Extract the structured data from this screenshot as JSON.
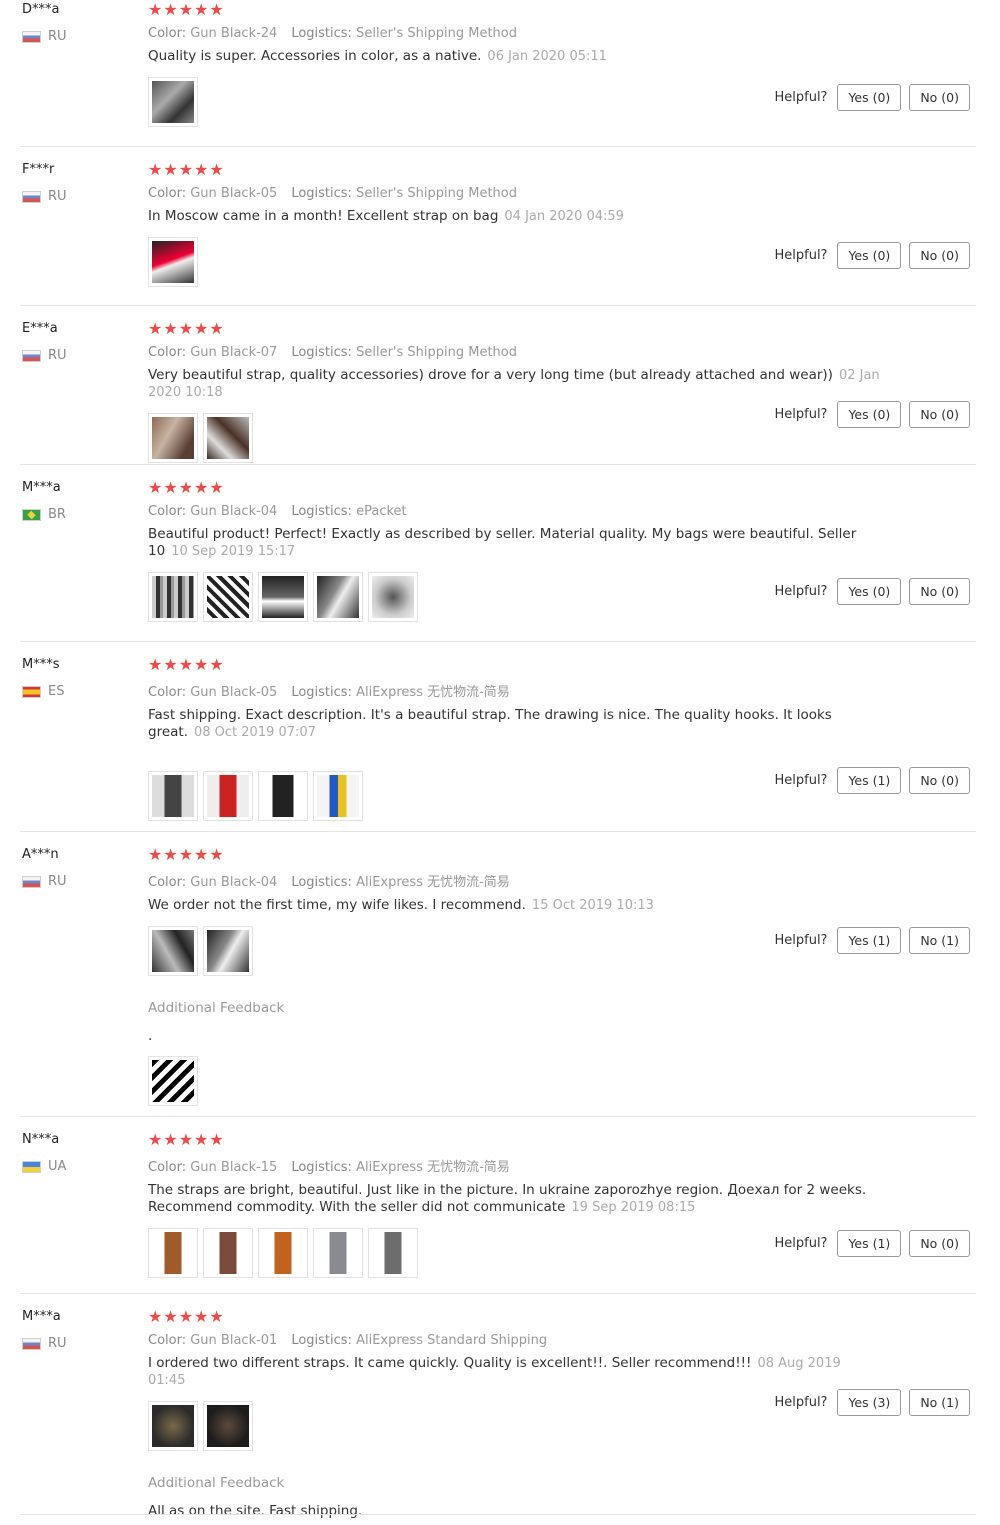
{
  "helpful_label": "Helpful?",
  "additional_feedback_label": "Additional Feedback",
  "color_label": "Color:",
  "logistics_label": "Logistics:",
  "star_glyphs": "★★★★★",
  "reviews": [
    {
      "user": "D***a",
      "country": "RU",
      "color": "Gun Black-24",
      "logistics": "Seller's Shipping Method",
      "text": "Quality is super. Accessories in color, as a native.",
      "date": "06 Jan 2020 05:11",
      "yes": "Yes (0)",
      "no": "No (0)"
    },
    {
      "user": "F***r",
      "country": "RU",
      "color": "Gun Black-05",
      "logistics": "Seller's Shipping Method",
      "text": "In Moscow came in a month! Excellent strap on bag",
      "date": "04 Jan 2020 04:59",
      "yes": "Yes (0)",
      "no": "No (0)"
    },
    {
      "user": "E***a",
      "country": "RU",
      "color": "Gun Black-07",
      "logistics": "Seller's Shipping Method",
      "text": "Very beautiful strap, quality accessories) drove for a very long time (but already attached and wear))",
      "date": "02 Jan 2020 10:18",
      "yes": "Yes (0)",
      "no": "No (0)"
    },
    {
      "user": "M***a",
      "country": "BR",
      "color": "Gun Black-04",
      "logistics": "ePacket",
      "text": "Beautiful product! Perfect! Exactly as described by seller. Material quality. My bags were beautiful. Seller 10",
      "date": "10 Sep 2019 15:17",
      "yes": "Yes (0)",
      "no": "No (0)"
    },
    {
      "user": "M***s",
      "country": "ES",
      "color": "Gun Black-05",
      "logistics": "AliExpress 无忧物流-简易",
      "text": "Fast shipping. Exact description. It's a beautiful strap. The drawing is nice. The quality hooks. It looks great.",
      "date": "08 Oct 2019 07:07",
      "yes": "Yes (1)",
      "no": "No (0)"
    },
    {
      "user": "A***n",
      "country": "RU",
      "color": "Gun Black-04",
      "logistics": "AliExpress 无忧物流-简易",
      "text": "We order not the first time, my wife likes. I recommend.",
      "date": "15 Oct 2019 10:13",
      "yes": "Yes (1)",
      "no": "No (1)",
      "additional_text": "."
    },
    {
      "user": "N***a",
      "country": "UA",
      "color": "Gun Black-15",
      "logistics": "AliExpress 无忧物流-简易",
      "text": "The straps are bright, beautiful. Just like in the picture. In ukraine zaporozhye region. Доехал for 2 weeks. Recommend commodity. With the seller did not communicate",
      "date": "19 Sep 2019 08:15",
      "yes": "Yes (1)",
      "no": "No (0)"
    },
    {
      "user": "M***a",
      "country": "RU",
      "color": "Gun Black-01",
      "logistics": "AliExpress Standard Shipping",
      "text": "I ordered two different straps. It came quickly. Quality is excellent!!. Seller recommend!!!",
      "date": "08 Aug 2019 01:45",
      "yes": "Yes (3)",
      "no": "No (1)",
      "additional_text": "All as on the site. Fast shipping."
    }
  ]
}
